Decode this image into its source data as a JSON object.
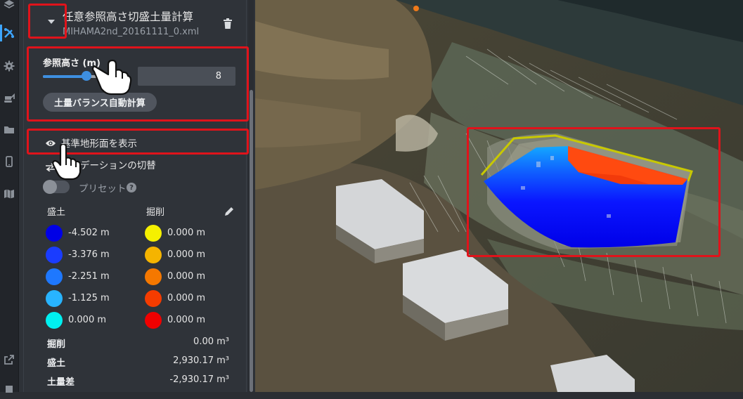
{
  "rail": {
    "icons": [
      "layers-icon",
      "cut-fill-tool-icon",
      "gear-icon",
      "excavator-icon",
      "folder-icon",
      "mobile-device-icon",
      "map-icon",
      "external-link-icon"
    ],
    "active_index": 1
  },
  "panel": {
    "title": "任意参照高さ切盛土量計算",
    "subtitle": "MIHAMA2nd_20161111_0.xml",
    "reference_height": {
      "label": "参照高さ (m)",
      "slider_fraction": 0.65,
      "value": "8"
    },
    "auto_balance_button": "土量バランス自動計算",
    "show_base_surface": "基準地形面を表示",
    "gradation_toggle": "グラデーションの切替",
    "preset_label": "プリセット",
    "fill_header": "盛土",
    "cut_header": "掘削",
    "fill_legend": [
      {
        "color": "#0000e6",
        "value": "-4.502 m"
      },
      {
        "color": "#1a3cff",
        "value": "-3.376 m"
      },
      {
        "color": "#1e78ff",
        "value": "-2.251 m"
      },
      {
        "color": "#28b4ff",
        "value": "-1.125 m"
      },
      {
        "color": "#00f0f0",
        "value": "0.000 m"
      }
    ],
    "cut_legend": [
      {
        "color": "#f5f000",
        "value": "0.000 m"
      },
      {
        "color": "#f5b400",
        "value": "0.000 m"
      },
      {
        "color": "#f57800",
        "value": "0.000 m"
      },
      {
        "color": "#f53c00",
        "value": "0.000 m"
      },
      {
        "color": "#f00000",
        "value": "0.000 m"
      }
    ],
    "summary": [
      {
        "label": "掘削",
        "value": "0.00 m³"
      },
      {
        "label": "盛土",
        "value": "2,930.17 m³"
      },
      {
        "label": "土量差",
        "value": "-2,930.17 m³"
      }
    ]
  },
  "colors": {
    "highlight_red": "#e0131b",
    "accent_blue": "#3ea6ff"
  }
}
